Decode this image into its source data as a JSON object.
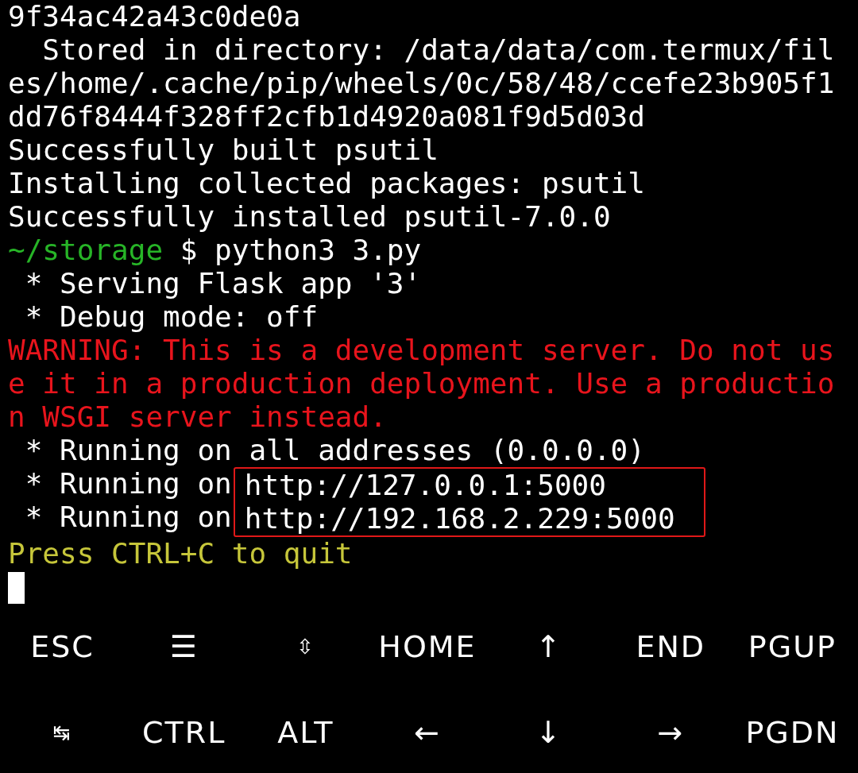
{
  "terminal": {
    "lines": [
      {
        "kind": "output",
        "text": "9f34ac42a43c0de0a"
      },
      {
        "kind": "output",
        "text": "  Stored in directory: /data/data/com.termux/files/home/.cache/pip/wheels/0c/58/48/ccefe23b905f1dd76f8444f328ff2cfb1d4920a081f9d5d03d"
      },
      {
        "kind": "output",
        "text": "Successfully built psutil"
      },
      {
        "kind": "output",
        "text": "Installing collected packages: psutil"
      },
      {
        "kind": "output",
        "text": "Successfully installed psutil-7.0.0"
      },
      {
        "kind": "prompt",
        "path": "~/storage",
        "command": "$ python3 3.py"
      },
      {
        "kind": "output",
        "text": " * Serving Flask app '3'"
      },
      {
        "kind": "output",
        "text": " * Debug mode: off"
      },
      {
        "kind": "warning",
        "text": "WARNING: This is a development server. Do not use it in a production deployment. Use a production WSGI server instead."
      },
      {
        "kind": "output",
        "text": " * Running on all addresses (0.0.0.0)"
      },
      {
        "kind": "highlighted",
        "rows": [
          {
            "prefix": " * Running on",
            "url": "http://127.0.0.1:5000"
          },
          {
            "prefix": " * Running on",
            "url": "http://192.168.2.229:5000"
          }
        ]
      },
      {
        "kind": "notice",
        "text": "Press CTRL+C to quit"
      }
    ],
    "cursor": true
  },
  "extra_keys": [
    [
      {
        "label": "ESC"
      },
      {
        "label": "☰"
      },
      {
        "label": "⇳",
        "small": true
      },
      {
        "label": "HOME"
      },
      {
        "label": "↑"
      },
      {
        "label": "END"
      },
      {
        "label": "PGUP"
      }
    ],
    [
      {
        "label": "↹",
        "small": true
      },
      {
        "label": "CTRL"
      },
      {
        "label": "ALT"
      },
      {
        "label": "←"
      },
      {
        "label": "↓"
      },
      {
        "label": "→"
      },
      {
        "label": "PGDN"
      }
    ]
  ]
}
